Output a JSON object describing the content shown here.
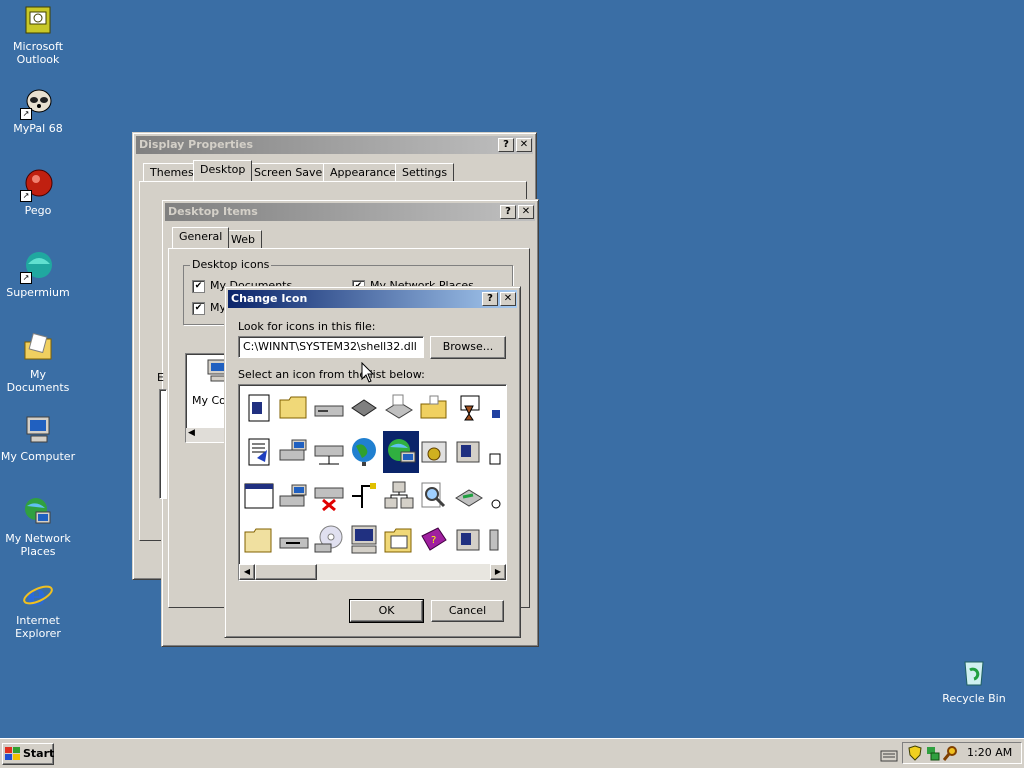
{
  "desktop": {
    "icons": [
      {
        "label": "Microsoft\nOutlook",
        "icon": "outlook-icon"
      },
      {
        "label": "MyPal 68",
        "icon": "mypal-icon"
      },
      {
        "label": "Pego",
        "icon": "pego-icon"
      },
      {
        "label": "Supermium",
        "icon": "supermium-icon"
      },
      {
        "label": "My Documents",
        "icon": "my-documents-icon"
      },
      {
        "label": "My Computer",
        "icon": "my-computer-icon"
      },
      {
        "label": "My Network\nPlaces",
        "icon": "my-network-places-icon"
      },
      {
        "label": "Internet\nExplorer",
        "icon": "internet-explorer-icon"
      }
    ],
    "recycle_bin": "Recycle Bin"
  },
  "display_properties": {
    "title": "Display Properties",
    "tabs": [
      "Themes",
      "Desktop",
      "Screen Saver",
      "Appearance",
      "Settings"
    ],
    "selected_tab": "Desktop"
  },
  "desktop_items": {
    "title": "Desktop Items",
    "tabs": [
      "General",
      "Web"
    ],
    "group_label": "Desktop icons",
    "checkboxes": [
      "My Documents",
      "My Network Places",
      "My"
    ],
    "partial_label_1": "My Co",
    "partial_label_2": "E"
  },
  "change_icon": {
    "title": "Change Icon",
    "file_label": "Look for icons in this file:",
    "file_value": "C:\\WINNT\\SYSTEM32\\shell32.dll",
    "browse_label": "Browse...",
    "list_label": "Select an icon from the list below:",
    "ok_label": "OK",
    "cancel_label": "Cancel"
  },
  "taskbar": {
    "start_label": "Start",
    "clock": "1:20 AM"
  },
  "colors": {
    "desktop": "#3a6ea5",
    "active_title": "#0a246a",
    "face": "#d4d0c8"
  }
}
